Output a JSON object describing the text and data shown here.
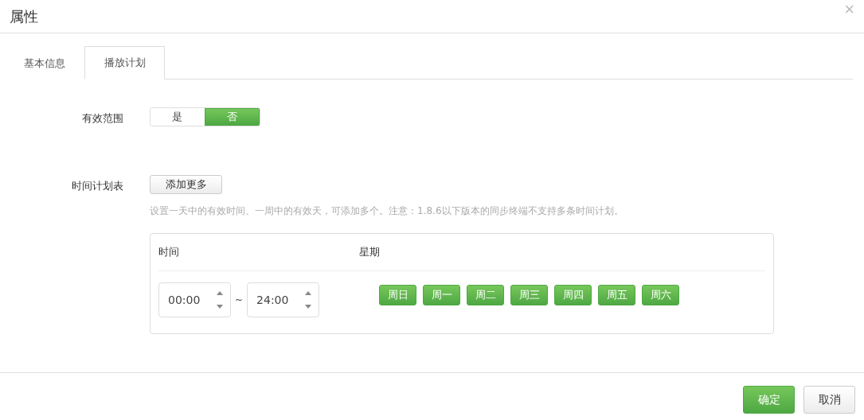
{
  "dialog": {
    "title": "属性",
    "close": "×"
  },
  "tabs": [
    {
      "label": "基本信息",
      "selected": false
    },
    {
      "label": "播放计划",
      "selected": true
    }
  ],
  "scope": {
    "label": "有效范围",
    "options": [
      {
        "label": "是",
        "selected": false
      },
      {
        "label": "否",
        "selected": true
      }
    ]
  },
  "schedule": {
    "label": "时间计划表",
    "add_button": "添加更多",
    "hint": "设置一天中的有效时间、一周中的有效天，可添加多个。注意：1.8.6以下版本的同步终端不支持多条时间计划。",
    "columns": [
      "时间",
      "星期"
    ],
    "rows": [
      {
        "start": "00:00",
        "separator": "~",
        "end": "24:00",
        "days": [
          {
            "label": "周日",
            "selected": true
          },
          {
            "label": "周一",
            "selected": true
          },
          {
            "label": "周二",
            "selected": true
          },
          {
            "label": "周三",
            "selected": true
          },
          {
            "label": "周四",
            "selected": true
          },
          {
            "label": "周五",
            "selected": true
          },
          {
            "label": "周六",
            "selected": true
          }
        ]
      }
    ]
  },
  "buttons": [
    {
      "label": "确定",
      "kind": "primary"
    },
    {
      "label": "取消",
      "kind": "default"
    }
  ]
}
